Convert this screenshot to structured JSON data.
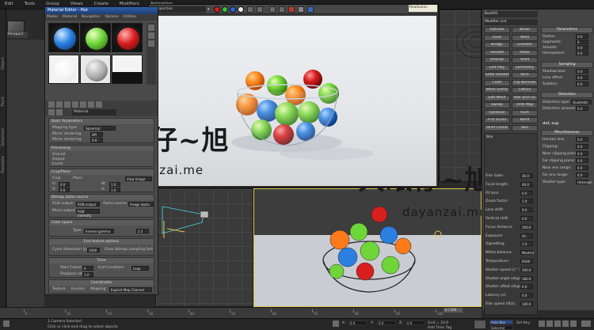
{
  "menubar": {
    "items": [
      "Edit",
      "Tools",
      "Group",
      "Views",
      "Create",
      "Modifiers",
      "Animation"
    ]
  },
  "left_toolbar": {
    "labels": [
      "Object",
      "Paint",
      "Selection",
      "Populate"
    ]
  },
  "viewport_label": "Perspect",
  "material_editor": {
    "title": "Material Editor - Mat",
    "menu": [
      "Modes",
      "Material",
      "Navigation",
      "Options",
      "Utilities"
    ],
    "material_name": "Material",
    "basic_params": {
      "title": "Basic Parameters",
      "mapping_label": "Mapping type:",
      "mapping_value": "Spherical",
      "rows": [
        {
          "label": "Mirror rendering",
          "value": "Off"
        },
        {
          "label": "Mirror rendering",
          "value": "0.0"
        }
      ]
    },
    "processing": {
      "title": "Processing",
      "rows": [
        "Overall",
        "Output",
        "Invert"
      ]
    },
    "crop_place": {
      "title": "Crop/Place",
      "view_image": "View Image",
      "crop": "Crop",
      "place": "Place",
      "u_label": "U:",
      "u": "0.0",
      "v_label": "V:",
      "v": "0.0",
      "w_label": "W:",
      "w": "1.0",
      "h_label": "H:",
      "h": "1.0"
    },
    "bitmap_alpha": {
      "title": "Bitmap alpha source",
      "rgb_output_label": "RGB output:",
      "rgb_output": "RGB output",
      "alpha_source_label": "Alpha source:",
      "alpha_source": "Image alpha",
      "mono_output_label": "Mono output:",
      "mono_output": "RGB intensity"
    },
    "color_space": {
      "title": "Color space",
      "type_label": "Type:",
      "type_value": "Inverse gamma",
      "gamma": "2.2"
    },
    "end_output": "End texture options",
    "cycle": "Cycle dimension (px)",
    "cycle_value": "1000",
    "clear_label": "Clear bitmap sampling fact",
    "time": {
      "title": "Time",
      "start_frame_label": "Start Frame:",
      "start_frame": "0",
      "end_condition_label": "End Condition:",
      "end_condition": "Loop",
      "playback_label": "Playback rate:",
      "playback": "1.0"
    },
    "coordinates": "Coordinates",
    "texture_label": "Texture",
    "environ_label": "Environ",
    "mapping_label": "Mapping:",
    "mapping_value": "Explicit Map Channel"
  },
  "render_window": {
    "dropdown": "Perspective",
    "right_tab": "Reallusion"
  },
  "command_panel": {
    "modifier_list": "Modifier List",
    "object_name": "Box001",
    "buttons": [
      [
        "Extrude",
        "Bevel"
      ],
      [
        "Inset",
        "Weld"
      ],
      [
        "Bridge",
        "Chamfer"
      ],
      [
        "Smooth",
        "Relax"
      ],
      [
        "Unwrap",
        "Shell"
      ],
      [
        "Edit Poly",
        "Symmetry"
      ],
      [
        "Turbo Smooth",
        "Slice"
      ],
      [
        "Cloth",
        "Flip Normals"
      ],
      [
        "Mesh Select",
        "Lattice"
      ],
      [
        "Edit Mesh",
        "Hair and Fur"
      ],
      [
        "Sweep",
        "UVW Map"
      ],
      [
        "Optimize",
        "Push"
      ],
      [
        "FFD 2x2x2",
        "Bend"
      ],
      [
        "Point Cache",
        "Skin"
      ]
    ],
    "stack_item": "Box",
    "params_title": "Parameters",
    "params": [
      {
        "label": "Radius:",
        "value": "0.0"
      },
      {
        "label": "Segments:",
        "value": "0"
      },
      {
        "label": "Smooth:",
        "value": "0.0"
      },
      {
        "label": "Hemisphere:",
        "value": "0.0"
      }
    ],
    "sampling_title": "Sampling",
    "sampling_rows": [
      {
        "label": "Shadow bias:",
        "value": "0.0"
      },
      {
        "label": "Lens effect:",
        "value": "0.0"
      },
      {
        "label": "Subdivs:",
        "value": "0.0"
      }
    ],
    "distortion_title": "Distortion",
    "distortion_type_label": "Distortion type:",
    "distortion_type": "Quadratic",
    "distortion_amount_label": "Distortion amount:",
    "distortion_amount": "0.0",
    "dof_label": "dof, exp",
    "misc_title": "Miscellaneous",
    "misc_rows": [
      {
        "label": "Horizon line:",
        "value": "0.0"
      },
      {
        "label": "Clipping:",
        "value": "0.0"
      },
      {
        "label": "Near clipping plane:",
        "value": "0.0"
      },
      {
        "label": "Far clipping plane:",
        "value": "0.0"
      },
      {
        "label": "Near env range:",
        "value": "0.0"
      },
      {
        "label": "Far env range:",
        "value": "0.0"
      },
      {
        "label": "Shutter type:",
        "value": "Unknown"
      }
    ],
    "lower_rows": [
      {
        "label": "Film Gate:",
        "value": "36.0"
      },
      {
        "label": "Focal length:",
        "value": "40.0"
      },
      {
        "label": "Fit lens:",
        "value": "0.0"
      },
      {
        "label": "Zoom factor:",
        "value": "1.0"
      },
      {
        "label": "Lens shift:",
        "value": "0.0"
      },
      {
        "label": "Vertical shift:",
        "value": "0.0"
      },
      {
        "label": "Focus distance:",
        "value": "200.0"
      },
      {
        "label": "Exposure:",
        "value": "On"
      },
      {
        "label": "Vignetting:",
        "value": "1.0"
      },
      {
        "label": "White balance:",
        "value": "Neutral"
      },
      {
        "label": "Temperature:",
        "value": "6500"
      },
      {
        "label": "Shutter speed (s^-1):",
        "value": "200.0"
      },
      {
        "label": "Shutter angle (deg):",
        "value": "180.0"
      },
      {
        "label": "Shutter offset (deg):",
        "value": "0.0"
      },
      {
        "label": "Latency (s):",
        "value": "0.0"
      },
      {
        "label": "Film speed (ISO):",
        "value": "100.0"
      }
    ]
  },
  "timeline": {
    "frame": "0 / 100",
    "ticks": [
      "0",
      "10",
      "20",
      "30",
      "40",
      "50",
      "60",
      "70",
      "80",
      "90",
      "100"
    ]
  },
  "statusbar": {
    "selected": "1 Camera Selected",
    "prompt": "Click or click-and-drag to select objects",
    "x_label": "X:",
    "x": "0.0",
    "y_label": "Y:",
    "y": "0.0",
    "z_label": "Z:",
    "z": "0.0",
    "grid": "Grid = 10.0",
    "add_time_tag": "Add Time Tag",
    "auto_key": "Auto Key",
    "selected_btn": "Selected",
    "set_key": "Set Key"
  },
  "watermark": {
    "logo_text": "大眼仔~旭",
    "url": "dayanzai.me"
  },
  "colors": {
    "ball_orange": "#ff7a1a",
    "ball_green": "#6fd63a",
    "ball_blue": "#2a7fe0",
    "ball_red": "#d91e1e",
    "accent_yellow": "#d8c64a"
  }
}
